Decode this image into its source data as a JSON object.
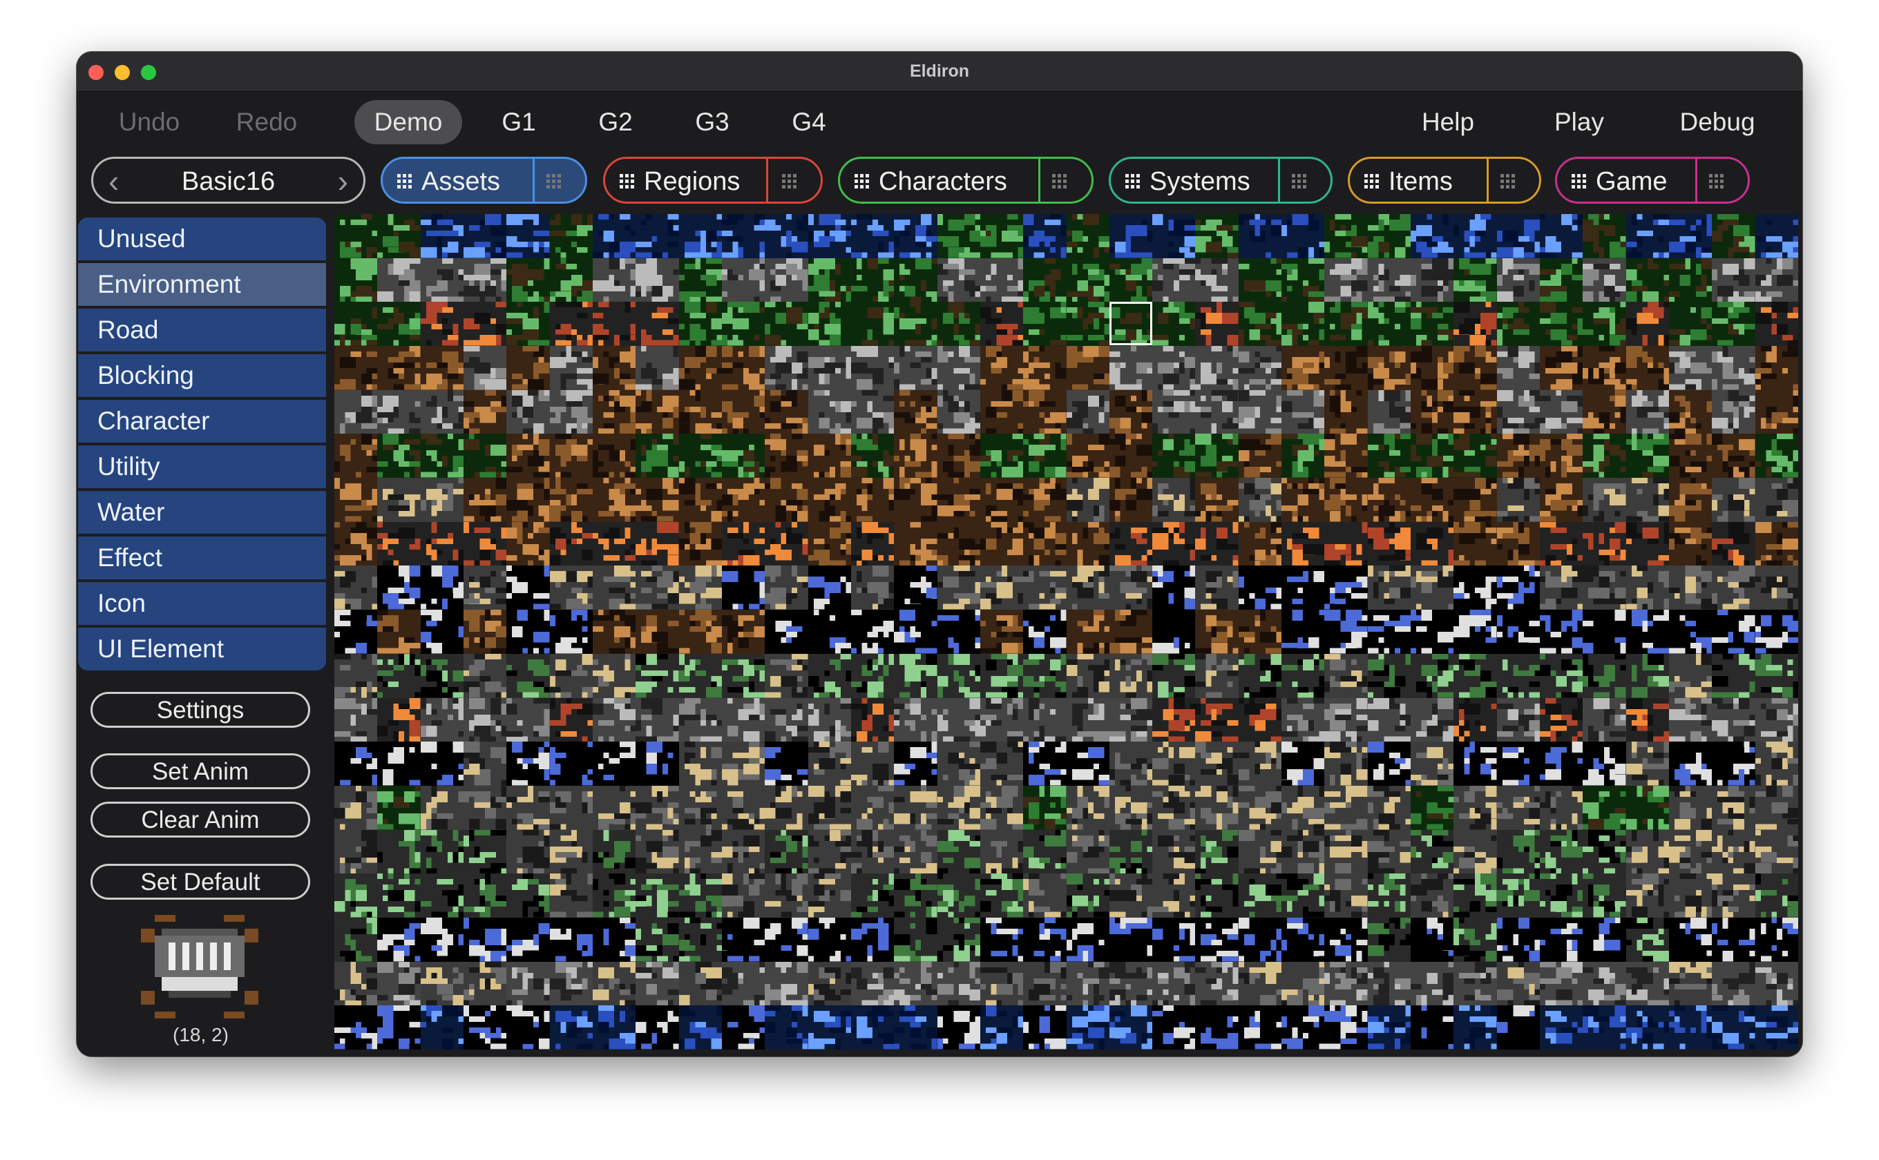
{
  "window": {
    "title": "Eldiron"
  },
  "menubar": {
    "undo": "Undo",
    "redo": "Redo",
    "tabs": [
      "Demo",
      "G1",
      "G2",
      "G3",
      "G4"
    ],
    "active_tab": "Demo",
    "help": "Help",
    "play": "Play",
    "debug": "Debug"
  },
  "toolbar": {
    "palette_picker": {
      "value": "Basic16"
    },
    "sections": [
      {
        "label": "Assets",
        "color": "#4a90e2"
      },
      {
        "label": "Regions",
        "color": "#d9463c"
      },
      {
        "label": "Characters",
        "color": "#3fbf4a"
      },
      {
        "label": "Systems",
        "color": "#2fb58f"
      },
      {
        "label": "Items",
        "color": "#d79a2b"
      },
      {
        "label": "Game",
        "color": "#c8308f"
      }
    ],
    "selected_section": "Assets"
  },
  "sidebar": {
    "categories": [
      "Unused",
      "Environment",
      "Road",
      "Blocking",
      "Character",
      "Utility",
      "Water",
      "Effect",
      "Icon",
      "UI Element"
    ],
    "selected_category": "Environment",
    "settings_button": "Settings",
    "set_anim_button": "Set Anim",
    "clear_anim_button": "Clear Anim",
    "set_default_button": "Set Default",
    "selected_tile_coords": "(18, 2)"
  },
  "tilegrid": {
    "columns": 34,
    "rows": 19
  }
}
